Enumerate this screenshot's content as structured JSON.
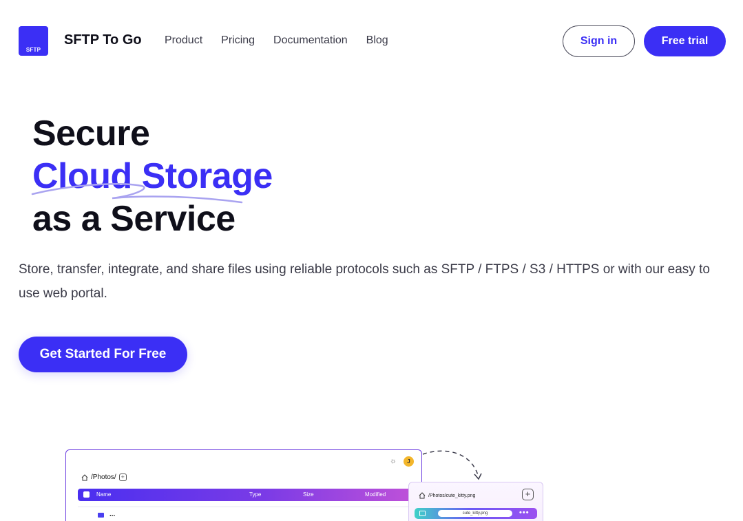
{
  "header": {
    "logo_text": "SFTP",
    "brand": "SFTP To Go",
    "nav": [
      "Product",
      "Pricing",
      "Documentation",
      "Blog"
    ],
    "sign_in": "Sign in",
    "free_trial": "Free trial"
  },
  "hero": {
    "line1": "Secure",
    "line2": "Cloud Storage",
    "line3": "as a Service",
    "description": "Store, transfer, integrate, and share files using reliable protocols such as SFTP / FTPS / S3 / HTTPS or with our easy to use web portal.",
    "cta": "Get Started For Free"
  },
  "illustration": {
    "avatar_initial": "J",
    "path": "/Photos/",
    "columns": [
      "Name",
      "Type",
      "Size",
      "Modified"
    ],
    "row1_name": "...",
    "card_path": "/Photos/cute_kitty.png",
    "card_file": "cute_kitty.png",
    "card_dots": "•••"
  },
  "colors": {
    "brand": "#3b2ff5",
    "text": "#0f0f1a"
  }
}
